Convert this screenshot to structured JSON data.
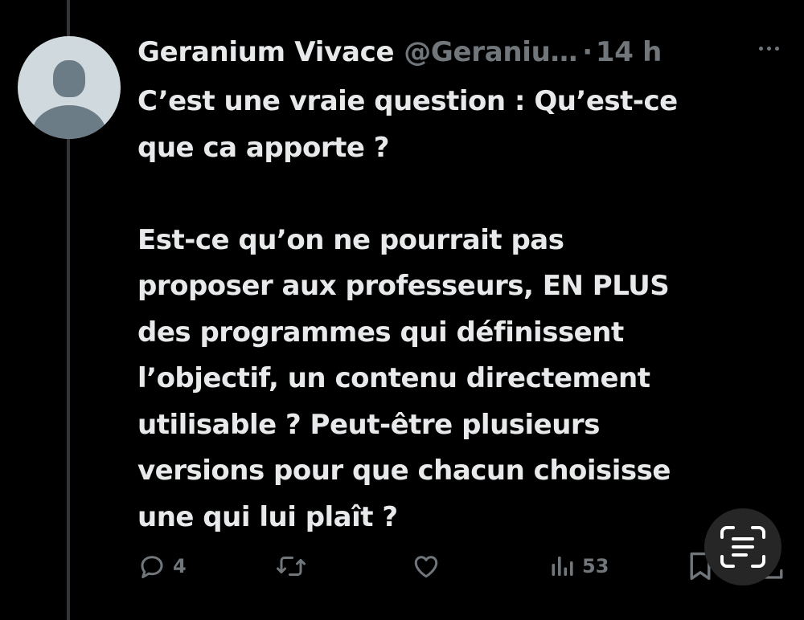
{
  "tweet": {
    "author_name": "Geranium Vivace",
    "handle": "@Geraniu…",
    "separator": "·",
    "time": "14 h",
    "paragraph1": "C’est une vraie question : Qu’est-ce\nque ca apporte ?",
    "paragraph2": "Est-ce qu’on ne pourrait pas\nproposer aux professeurs, EN PLUS\ndes programmes qui définissent\nl’objectif, un contenu directement\nutilisable ? Peut-être plusieurs\nversions pour que chacun choisisse\nune qui lui plaît ?"
  },
  "actions": {
    "reply_count": "4",
    "views_count": "53"
  },
  "icons": {
    "avatar": "default-avatar",
    "more": "more-icon",
    "reply": "reply-icon",
    "retweet": "retweet-icon",
    "like": "like-icon",
    "views": "views-icon",
    "bookmark": "bookmark-icon",
    "share": "share-icon",
    "live_text": "live-text-scan-icon"
  },
  "colors": {
    "background": "#000000",
    "text": "#e7e9ea",
    "secondary": "#71767b"
  }
}
